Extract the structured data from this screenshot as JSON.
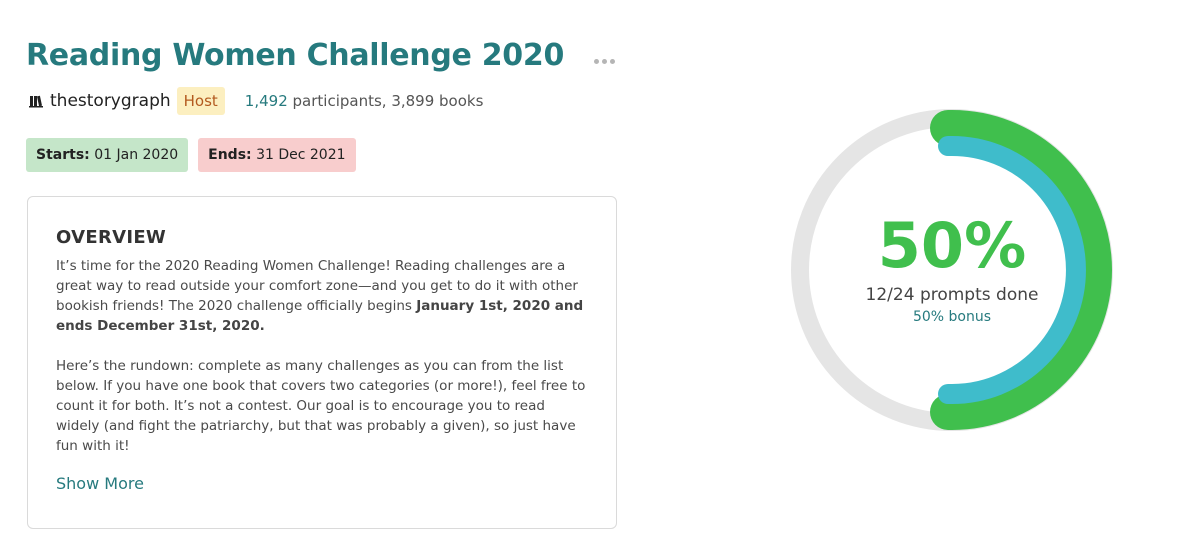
{
  "challenge": {
    "title": "Reading Women Challenge 2020",
    "host_name": "thestorygraph",
    "host_badge": "Host",
    "participants_count": "1,492",
    "stats_rest": " participants, 3,899 books",
    "start_label": "Starts:",
    "start_date": "01 Jan 2020",
    "end_label": "Ends:",
    "end_date": "31 Dec 2021"
  },
  "overview": {
    "heading": "OVERVIEW",
    "p1_text": "It’s time for the 2020 Reading Women Challenge! Reading challenges are a great way to read outside your comfort zone—and you get to do it with other bookish friends! The 2020 challenge officially begins ",
    "p1_bold": "January 1st, 2020 and ends December 31st, 2020.",
    "p2_text": "Here’s the rundown: complete as many challenges as you can from the list below. If you have one book that covers two categories (or more!), feel free to count it for both. It’s not a contest. Our goal is to encourage you to read widely (and fight the patriarchy, but that was probably a given), so just have fun with it!",
    "show_more": "Show More"
  },
  "progress": {
    "percent_label": "50%",
    "prompts_label": "12/24 prompts done",
    "bonus_label": "50% bonus",
    "percent_value": 0.5,
    "bonus_value": 0.5
  },
  "icons": {
    "more": "more-horizontal-icon",
    "logo": "storygraph-logo-icon"
  },
  "colors": {
    "title": "#267a7e",
    "progress": "#40bf4d",
    "bonus": "#3fbccb",
    "track": "#e5e5e5",
    "host_badge_bg": "#fcefc0",
    "host_badge_text": "#b35a1f",
    "start_badge_bg": "#c5e6c9",
    "end_badge_bg": "#f8cdcd"
  }
}
